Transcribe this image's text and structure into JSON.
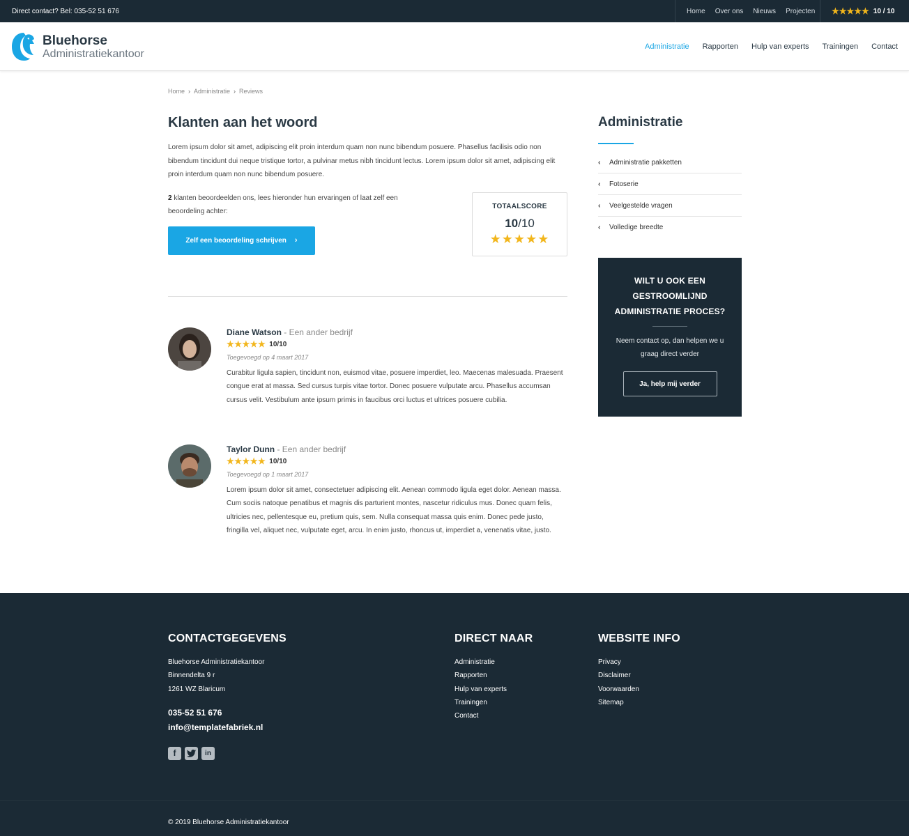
{
  "topbar": {
    "contact": "Direct contact? Bel: 035-52 51 676",
    "links": [
      "Home",
      "Over ons",
      "Nieuws",
      "Projecten"
    ],
    "rating_stars": "★★★★★",
    "rating_value": "10 / 10"
  },
  "header": {
    "logo_name": "Bluehorse",
    "logo_sub": "Administratiekantoor",
    "nav": [
      "Administratie",
      "Rapporten",
      "Hulp van experts",
      "Trainingen",
      "Contact"
    ],
    "active_nav": "Administratie"
  },
  "breadcrumb": [
    "Home",
    "Administratie",
    "Reviews"
  ],
  "main": {
    "title": "Klanten aan het woord",
    "intro": "Lorem ipsum dolor sit amet, adipiscing elit proin interdum quam non nunc bibendum posuere. Phasellus facilisis odio non bibendum tincidunt dui neque tristique tortor, a pulvinar metus nibh tincidunt lectus. Lorem ipsum dolor sit amet, adipiscing elit proin interdum quam non nunc bibendum posuere.",
    "count": "2",
    "count_text": " klanten beoordeelden ons, lees hieronder hun ervaringen of laat zelf een beoordeling achter:",
    "write_button": "Zelf een beoordeling schrijven",
    "score": {
      "label": "TOTAALSCORE",
      "value": "10",
      "max": "/10",
      "stars": "★★★★★",
      "rating": 10
    }
  },
  "reviews": [
    {
      "name": "Diane Watson",
      "company": " - Een ander bedrijf",
      "stars": "★★★★★",
      "rating": "10/10",
      "date": "Toegevoegd op 4 maart 2017",
      "text": "Curabitur ligula sapien, tincidunt non, euismod vitae, posuere imperdiet, leo. Maecenas malesuada. Praesent congue erat at massa. Sed cursus turpis vitae tortor. Donec posuere vulputate arcu. Phasellus accumsan cursus velit. Vestibulum ante ipsum primis in faucibus orci luctus et ultrices posuere cubilia."
    },
    {
      "name": "Taylor Dunn",
      "company": " - Een ander bedrijf",
      "stars": "★★★★★",
      "rating": "10/10",
      "date": "Toegevoegd op 1 maart 2017",
      "text": "Lorem ipsum dolor sit amet, consectetuer adipiscing elit. Aenean commodo ligula eget dolor. Aenean massa. Cum sociis natoque penatibus et magnis dis parturient montes, nascetur ridiculus mus. Donec quam felis, ultricies nec, pellentesque eu, pretium quis, sem. Nulla consequat massa quis enim. Donec pede justo, fringilla vel, aliquet nec, vulputate eget, arcu. In enim justo, rhoncus ut, imperdiet a, venenatis vitae, justo."
    }
  ],
  "sidebar": {
    "title": "Administratie",
    "items": [
      "Administratie pakketten",
      "Fotoserie",
      "Veelgestelde vragen",
      "Volledige breedte"
    ]
  },
  "cta": {
    "title_lines": [
      "WILT U OOK EEN",
      "GESTROOMLIJND",
      "ADMINISTRATIE PROCES?"
    ],
    "text_lines": [
      "Neem contact op, dan helpen we u",
      "graag direct verder"
    ],
    "button": "Ja, help mij verder"
  },
  "footer": {
    "contact": {
      "title": "CONTACTGEGEVENS",
      "company": "Bluehorse Administratiekantoor",
      "street": "Binnendelta 9 r",
      "city": "1261 WZ Blaricum",
      "phone": "035-52 51 676",
      "email": "info@templatefabriek.nl",
      "socials": [
        "facebook-icon",
        "twitter-icon",
        "linkedin-icon"
      ]
    },
    "direct": {
      "title": "DIRECT NAAR",
      "links": [
        "Administratie",
        "Rapporten",
        "Hulp van experts",
        "Trainingen",
        "Contact"
      ]
    },
    "info": {
      "title": "WEBSITE INFO",
      "links": [
        "Privacy",
        "Disclaimer",
        "Voorwaarden",
        "Sitemap"
      ]
    },
    "copyright": "© 2019 Bluehorse Administratiekantoor"
  },
  "colors": {
    "dark": "#1b2a35",
    "accent": "#1aa6e4",
    "star": "#f2b61c"
  }
}
